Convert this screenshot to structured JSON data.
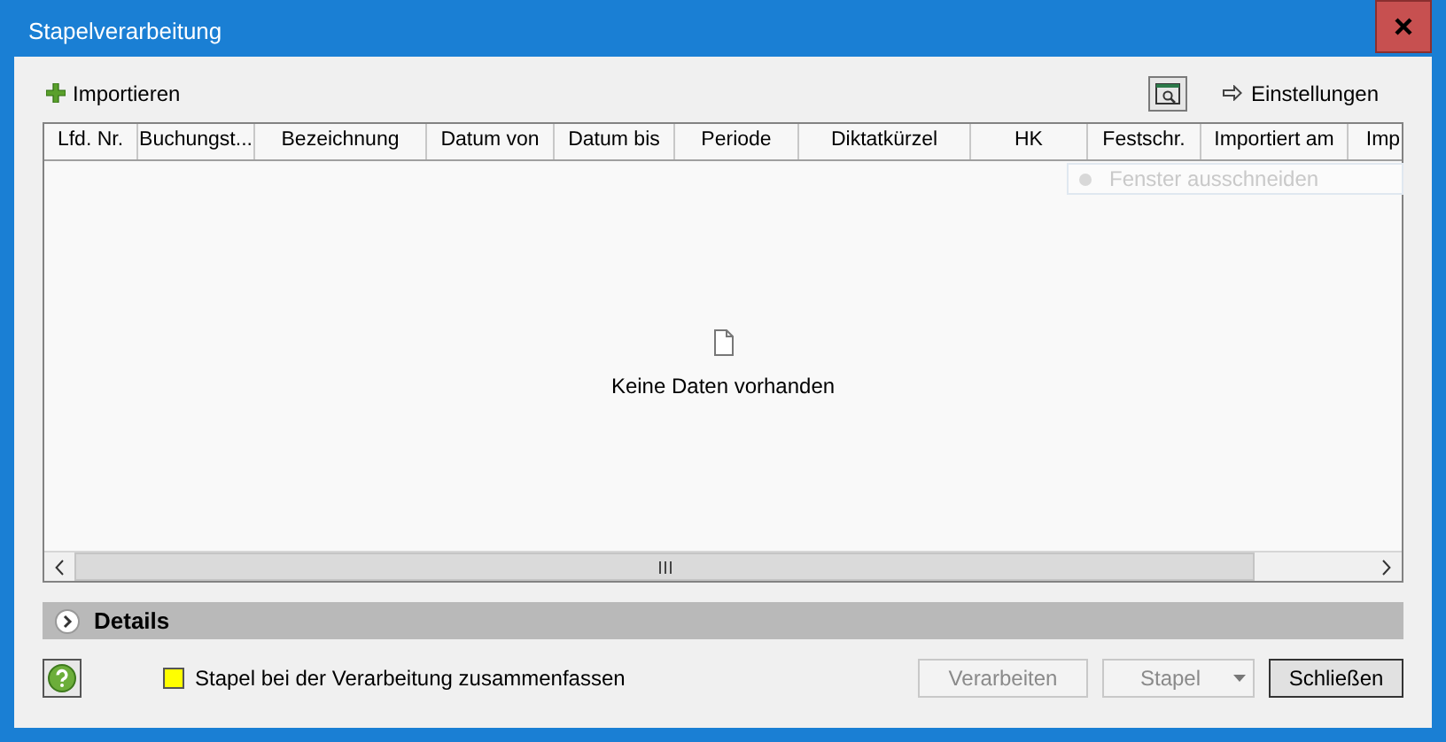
{
  "window": {
    "title": "Stapelverarbeitung"
  },
  "toolbar": {
    "import_label": "Importieren",
    "settings_label": "Einstellungen"
  },
  "tooltip": {
    "text": "Fenster ausschneiden"
  },
  "table": {
    "columns": [
      "Lfd. Nr.",
      "Buchungst...",
      "Bezeichnung",
      "Datum von",
      "Datum bis",
      "Periode",
      "Diktatkürzel",
      "HK",
      "Festschr.",
      "Importiert am",
      "Imp"
    ],
    "empty_text": "Keine Daten vorhanden"
  },
  "details": {
    "label": "Details",
    "expanded": false
  },
  "option": {
    "label": "Stapel bei der Verarbeitung zusammenfassen",
    "checked": false
  },
  "buttons": [
    {
      "label": "Verarbeiten",
      "kind": "plain",
      "disabled": true
    },
    {
      "label": "Stapel",
      "kind": "split",
      "disabled": true
    },
    {
      "label": "Schließen",
      "kind": "plain",
      "disabled": false
    }
  ]
}
